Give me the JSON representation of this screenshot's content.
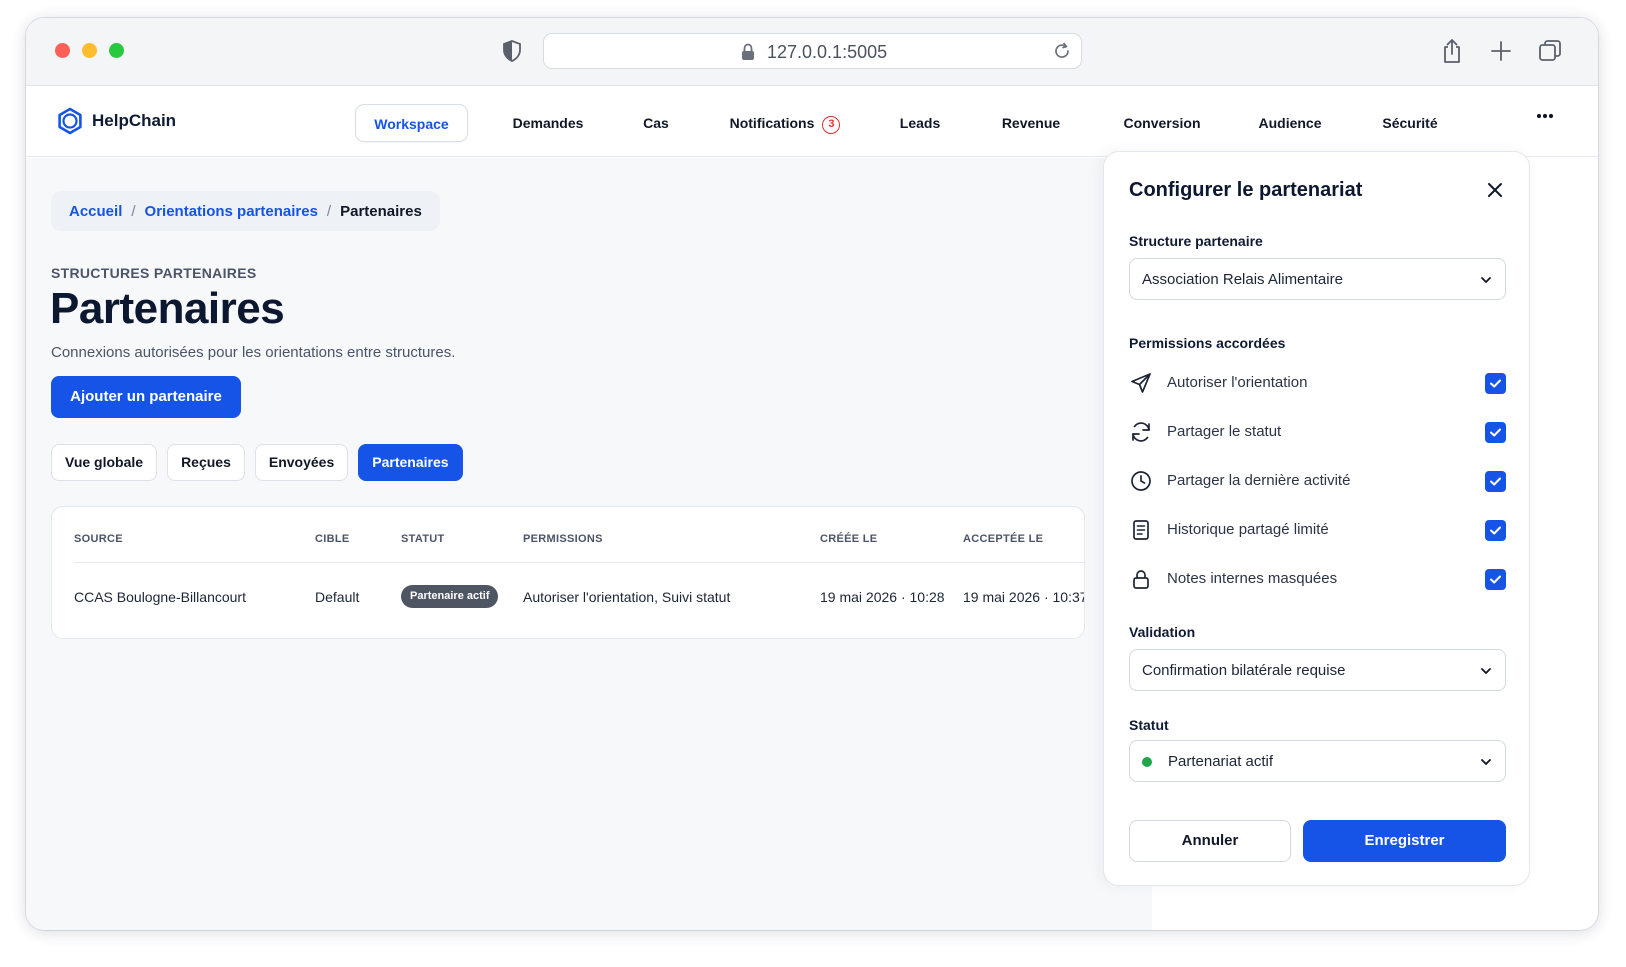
{
  "browser": {
    "url": "127.0.0.1:5005"
  },
  "app": {
    "name": "HelpChain",
    "nav": [
      {
        "label": "Workspace",
        "active": true
      },
      {
        "label": "Demandes"
      },
      {
        "label": "Cas"
      },
      {
        "label": "Notifications",
        "badge": "3"
      },
      {
        "label": "Leads"
      },
      {
        "label": "Revenue"
      },
      {
        "label": "Conversion"
      },
      {
        "label": "Audience"
      },
      {
        "label": "Sécurité"
      }
    ]
  },
  "breadcrumb": {
    "home": "Accueil",
    "parent": "Orientations partenaires",
    "current": "Partenaires",
    "separator": "/"
  },
  "page": {
    "eyebrow": "STRUCTURES PARTENAIRES",
    "title": "Partenaires",
    "subtitle": "Connexions autorisées pour les orientations entre structures.",
    "add_button": "Ajouter un partenaire"
  },
  "tabs": [
    {
      "label": "Vue globale"
    },
    {
      "label": "Reçues"
    },
    {
      "label": "Envoyées"
    },
    {
      "label": "Partenaires",
      "active": true
    }
  ],
  "table": {
    "headers": [
      "SOURCE",
      "CIBLE",
      "STATUT",
      "PERMISSIONS",
      "CRÉÉE LE",
      "ACCEPTÉE LE"
    ],
    "rows": [
      {
        "source": "CCAS Boulogne-Billancourt",
        "target": "Default",
        "status": "Partenaire actif",
        "permissions": "Autoriser l'orientation, Suivi statut",
        "created": "19 mai 2026 · 10:28",
        "accepted": "19 mai 2026 · 10:37"
      }
    ]
  },
  "panel": {
    "title": "Configurer le partenariat",
    "structure_label": "Structure partenaire",
    "structure_value": "Association Relais Alimentaire",
    "permissions_label": "Permissions accordées",
    "permissions": [
      {
        "label": "Autoriser l'orientation",
        "icon": "send-icon",
        "checked": true
      },
      {
        "label": "Partager le statut",
        "icon": "refresh-icon",
        "checked": true
      },
      {
        "label": "Partager la dernière activité",
        "icon": "clock-icon",
        "checked": true
      },
      {
        "label": "Historique partagé limité",
        "icon": "document-icon",
        "checked": true
      },
      {
        "label": "Notes internes masquées",
        "icon": "lock-icon",
        "checked": true
      }
    ],
    "validation_label": "Validation",
    "validation_value": "Confirmation bilatérale requise",
    "status_label": "Statut",
    "status_value": "Partenariat actif",
    "status_color": "#1fa64a",
    "cancel": "Annuler",
    "save": "Enregistrer"
  },
  "colors": {
    "accent": "#1554e6",
    "badge": "#e0302a"
  }
}
